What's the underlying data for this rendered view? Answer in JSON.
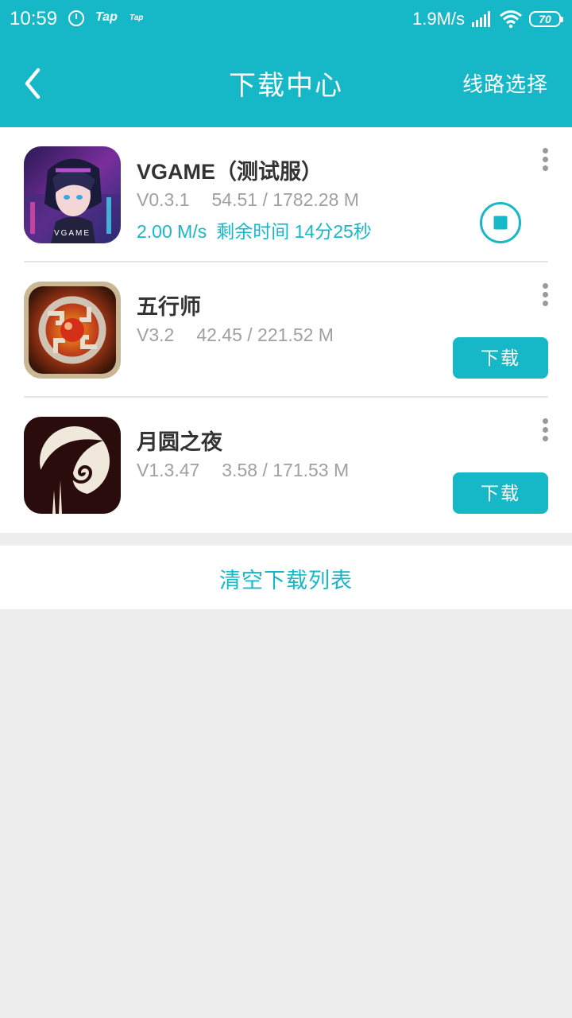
{
  "status_bar": {
    "time": "10:59",
    "tap_big": "Tap",
    "tap_small": "Tap",
    "net_speed": "1.9M/s",
    "battery": "70"
  },
  "header": {
    "title": "下载中心",
    "route_label": "线路选择"
  },
  "downloads": [
    {
      "name": "VGAME（测试服）",
      "version": "V0.3.1",
      "progress": "54.51 / 1782.28 M",
      "speed": "2.00 M/s",
      "remaining": "剩余时间 14分25秒",
      "icon_text": "VGAME",
      "state": "downloading"
    },
    {
      "name": "五行师",
      "version": "V3.2",
      "progress": "42.45 / 221.52 M",
      "button": "下载",
      "state": "paused"
    },
    {
      "name": "月圆之夜",
      "version": "V1.3.47",
      "progress": "3.58 / 171.53 M",
      "button": "下载",
      "state": "paused"
    }
  ],
  "clear_label": "清空下载列表",
  "colors": {
    "accent": "#16b8c8",
    "background": "#ededed",
    "secondary_text": "#a0a0a0"
  }
}
